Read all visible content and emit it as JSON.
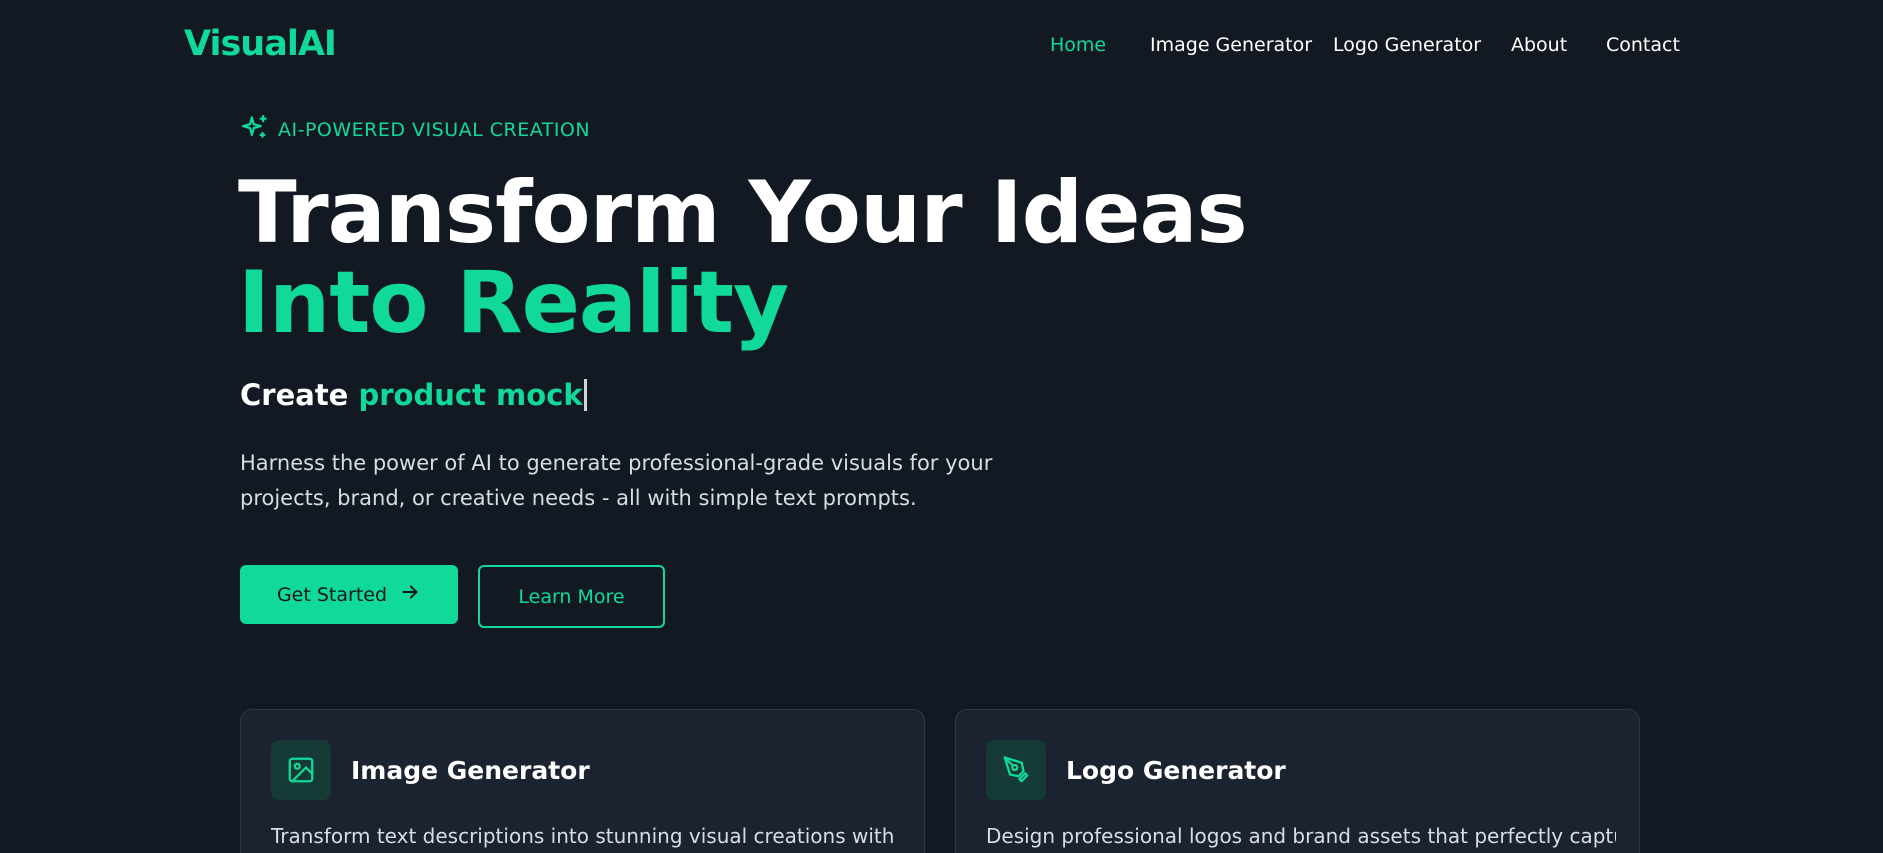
{
  "brand": {
    "name": "VisualAI"
  },
  "nav": {
    "items": [
      {
        "label": "Home",
        "active": true
      },
      {
        "label": "Image Generator",
        "active": false
      },
      {
        "label": "Logo Generator",
        "active": false
      },
      {
        "label": "About",
        "active": false
      },
      {
        "label": "Contact",
        "active": false
      }
    ]
  },
  "hero": {
    "eyebrow": "AI-POWERED VISUAL CREATION",
    "eyebrow_icon": "sparkles-icon",
    "title_line1": "Transform Your Ideas",
    "title_line2": "Into Reality",
    "typing_prefix": "Create",
    "typing_word": "product mock",
    "description": "Harness the power of AI to generate professional-grade visuals for your projects, brand, or creative needs - all with simple text prompts.",
    "primary_button": "Get Started",
    "primary_button_icon": "arrow-right-icon",
    "secondary_button": "Learn More"
  },
  "features": [
    {
      "title": "Image Generator",
      "icon": "image-icon",
      "description": "Transform text descriptions into stunning visual creations with our AI-"
    },
    {
      "title": "Logo Generator",
      "icon": "pen-tool-icon",
      "description": "Design professional logos and brand assets that perfectly capture your"
    }
  ],
  "colors": {
    "accent": "#10d99a",
    "background": "#131922",
    "card": "#1c2330",
    "text": "#ffffff"
  }
}
